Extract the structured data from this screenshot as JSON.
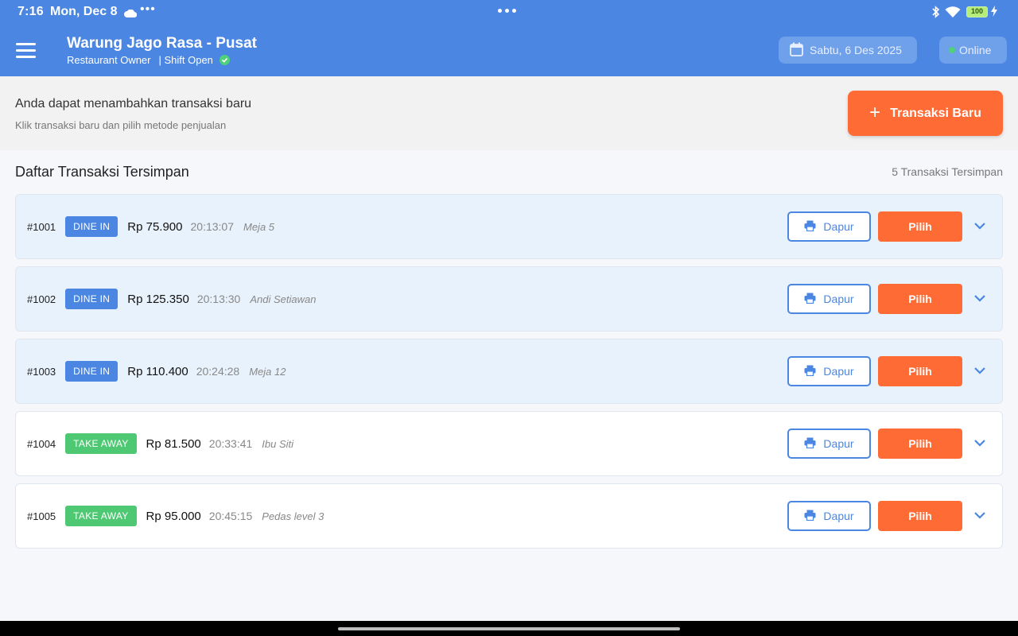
{
  "status_bar": {
    "time": "7:16",
    "date": "Mon, Dec 8",
    "more_dots": "•••",
    "battery": "100"
  },
  "app_bar": {
    "store_name": "Warung Jago Rasa - Pusat",
    "role": "Restaurant Owner",
    "shift_status": "| Shift Open",
    "date_label": "Sabtu, 6 Des 2025",
    "connection_status": "Online"
  },
  "colors": {
    "primary": "#4a86e2",
    "accent": "#ff6b35",
    "dine_in": "#4a86e2",
    "take_away": "#4fc874",
    "online": "#4fd07a"
  },
  "info": {
    "title": "Anda dapat menambahkan transaksi baru",
    "subtitle": "Klik transaksi baru dan pilih metode penjualan",
    "new_button_label": "Transaksi Baru"
  },
  "list": {
    "title": "Daftar Transaksi Tersimpan",
    "count_label": "5 Transaksi Tersimpan",
    "kitchen_label": "Dapur",
    "select_label": "Pilih",
    "transactions": [
      {
        "id": "#1001",
        "type": "DINE IN",
        "amount": "Rp 75.900",
        "time": "20:13:07",
        "note": "Meja 5"
      },
      {
        "id": "#1002",
        "type": "DINE IN",
        "amount": "Rp 125.350",
        "time": "20:13:30",
        "note": "Andi Setiawan"
      },
      {
        "id": "#1003",
        "type": "DINE IN",
        "amount": "Rp 110.400",
        "time": "20:24:28",
        "note": "Meja 12"
      },
      {
        "id": "#1004",
        "type": "TAKE AWAY",
        "amount": "Rp 81.500",
        "time": "20:33:41",
        "note": "Ibu Siti"
      },
      {
        "id": "#1005",
        "type": "TAKE AWAY",
        "amount": "Rp 95.000",
        "time": "20:45:15",
        "note": "Pedas level 3"
      }
    ]
  },
  "icons": {
    "menu": "hamburger-icon",
    "calendar": "calendar-icon",
    "printer": "printer-icon",
    "expand": "chevron-down-icon",
    "add": "plus-icon"
  }
}
